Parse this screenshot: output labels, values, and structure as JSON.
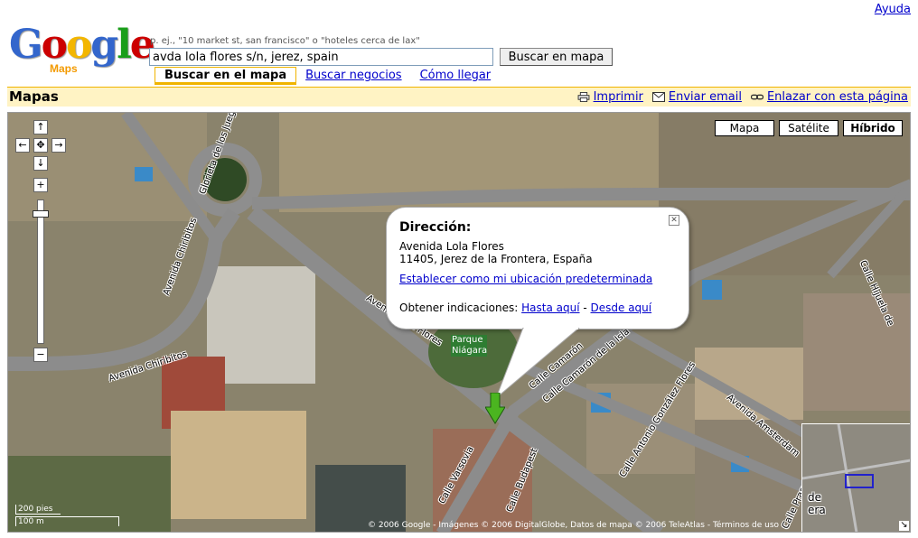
{
  "header": {
    "help": "Ayuda",
    "logo_text": "Google",
    "logo_sub": "Maps",
    "hint": "p. ej., \"10 market st, san francisco\" o \"hoteles cerca de lax\"",
    "search_value": "avda lola flores s/n, jerez, spain",
    "search_button": "Buscar en mapa",
    "tabs": [
      "Buscar en el mapa",
      "Buscar negocios",
      "Cómo llegar"
    ]
  },
  "bar": {
    "title": "Mapas",
    "print": "Imprimir",
    "email": "Enviar email",
    "link": "Enlazar con esta página"
  },
  "map": {
    "types": [
      "Mapa",
      "Satélite",
      "Híbrido"
    ],
    "selected_type": "Híbrido",
    "bubble": {
      "heading": "Dirección:",
      "line1": "Avenida Lola Flores",
      "line2": "11405, Jerez de la Frontera, España",
      "set_default": "Establecer como mi ubicación predeterminada",
      "directions_label": "Obtener indicaciones:",
      "to_here": "Hasta aquí",
      "sep": " - ",
      "from_here": "Desde aquí"
    },
    "park": "Parque Niágara",
    "streets": [
      "Glorieta de los Juegos Olímpicos",
      "Avenida Chiribitos",
      "Avenida Chiribitos",
      "Avenida Lola Flores",
      "Calle Camarón de la Isla",
      "Calle Camarón",
      "Calle Antonio González Flores",
      "Avenida Amsterdam",
      "Calle Varsovia",
      "Calle Budapest",
      "Calle Hijuela de",
      "Calle Praga"
    ],
    "scale": [
      "200 pies",
      "100 m"
    ],
    "copyright": "© 2006 Google - Imágenes © 2006 DigitalGlobe, Datos de mapa © 2006 TeleAtlas - Términos de uso",
    "overview_label": "de era"
  },
  "colors": {
    "link": "#0000cc",
    "bar_bg": "#fff3c4",
    "accent": "#f0b400",
    "marker": "#4bb520"
  }
}
